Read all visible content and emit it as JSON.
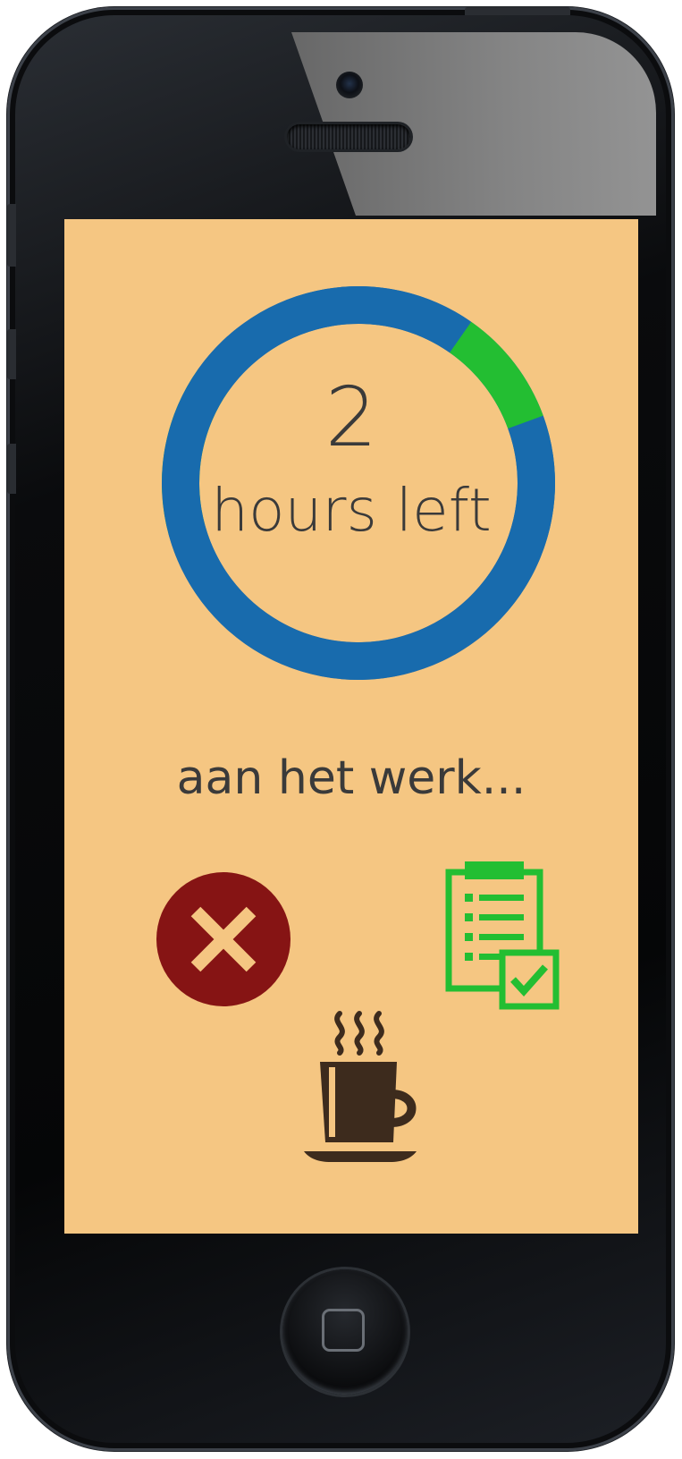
{
  "timer": {
    "value": "2",
    "unit_label": "hours left",
    "segments": [
      {
        "color": "#186bad",
        "from_deg": -90,
        "to_deg": 45
      },
      {
        "color": "#808080",
        "from_deg": 45,
        "to_deg": 120
      },
      {
        "color": "#186bad",
        "from_deg": 120,
        "to_deg": 165
      },
      {
        "color": "#23be32",
        "from_deg": 165,
        "to_deg": 215
      },
      {
        "color": "#186bad",
        "from_deg": 215,
        "to_deg": 305
      },
      {
        "color": "#23be32",
        "from_deg": 305,
        "to_deg": 340
      },
      {
        "color": "#186bad",
        "from_deg": 340,
        "to_deg": 270
      }
    ]
  },
  "status_text": "aan het werk...",
  "actions": {
    "cancel": {
      "icon": "close-icon",
      "color": "#861414",
      "glyph_color": "#f5c682"
    },
    "tasks": {
      "icon": "clipboard-checklist-icon",
      "color": "#23be32"
    },
    "break": {
      "icon": "coffee-cup-icon",
      "color": "#3d2b1d"
    }
  },
  "colors": {
    "screen_background": "#f5c682",
    "text": "#3a3a3a",
    "ring_blue": "#186bad",
    "ring_green": "#23be32",
    "ring_grey": "#808080"
  }
}
